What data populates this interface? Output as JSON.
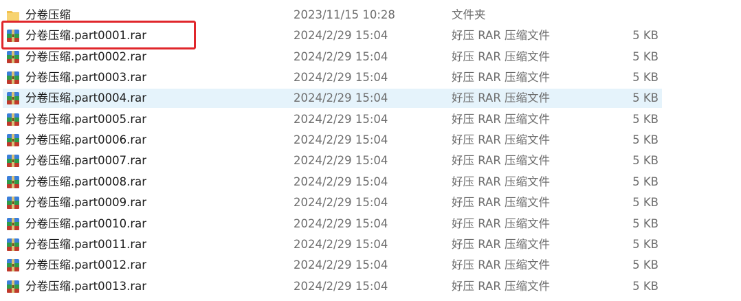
{
  "files": [
    {
      "name": "分卷压缩",
      "date": "2023/11/15 10:28",
      "type": "文件夹",
      "size": "",
      "icon": "folder-icon"
    },
    {
      "name": "分卷压缩.part0001.rar",
      "date": "2024/2/29 15:04",
      "type": "好压 RAR 压缩文件",
      "size": "5 KB",
      "icon": "rar-archive-icon"
    },
    {
      "name": "分卷压缩.part0002.rar",
      "date": "2024/2/29 15:04",
      "type": "好压 RAR 压缩文件",
      "size": "5 KB",
      "icon": "rar-archive-icon"
    },
    {
      "name": "分卷压缩.part0003.rar",
      "date": "2024/2/29 15:04",
      "type": "好压 RAR 压缩文件",
      "size": "5 KB",
      "icon": "rar-archive-icon"
    },
    {
      "name": "分卷压缩.part0004.rar",
      "date": "2024/2/29 15:04",
      "type": "好压 RAR 压缩文件",
      "size": "5 KB",
      "icon": "rar-archive-icon"
    },
    {
      "name": "分卷压缩.part0005.rar",
      "date": "2024/2/29 15:04",
      "type": "好压 RAR 压缩文件",
      "size": "5 KB",
      "icon": "rar-archive-icon"
    },
    {
      "name": "分卷压缩.part0006.rar",
      "date": "2024/2/29 15:04",
      "type": "好压 RAR 压缩文件",
      "size": "5 KB",
      "icon": "rar-archive-icon"
    },
    {
      "name": "分卷压缩.part0007.rar",
      "date": "2024/2/29 15:04",
      "type": "好压 RAR 压缩文件",
      "size": "5 KB",
      "icon": "rar-archive-icon"
    },
    {
      "name": "分卷压缩.part0008.rar",
      "date": "2024/2/29 15:04",
      "type": "好压 RAR 压缩文件",
      "size": "5 KB",
      "icon": "rar-archive-icon"
    },
    {
      "name": "分卷压缩.part0009.rar",
      "date": "2024/2/29 15:04",
      "type": "好压 RAR 压缩文件",
      "size": "5 KB",
      "icon": "rar-archive-icon"
    },
    {
      "name": "分卷压缩.part0010.rar",
      "date": "2024/2/29 15:04",
      "type": "好压 RAR 压缩文件",
      "size": "5 KB",
      "icon": "rar-archive-icon"
    },
    {
      "name": "分卷压缩.part0011.rar",
      "date": "2024/2/29 15:04",
      "type": "好压 RAR 压缩文件",
      "size": "5 KB",
      "icon": "rar-archive-icon"
    },
    {
      "name": "分卷压缩.part0012.rar",
      "date": "2024/2/29 15:04",
      "type": "好压 RAR 压缩文件",
      "size": "5 KB",
      "icon": "rar-archive-icon"
    },
    {
      "name": "分卷压缩.part0013.rar",
      "date": "2024/2/29 15:04",
      "type": "好压 RAR 压缩文件",
      "size": "5 KB",
      "icon": "rar-archive-icon"
    }
  ],
  "hovered_row": 4,
  "annotated_row": 1,
  "colors": {
    "hover_background": "#e5f3fb",
    "annotation_border": "#e0262b",
    "folder": "#f2c14e",
    "archive_blue": "#3b7fd9",
    "archive_green": "#2e9b4a"
  }
}
